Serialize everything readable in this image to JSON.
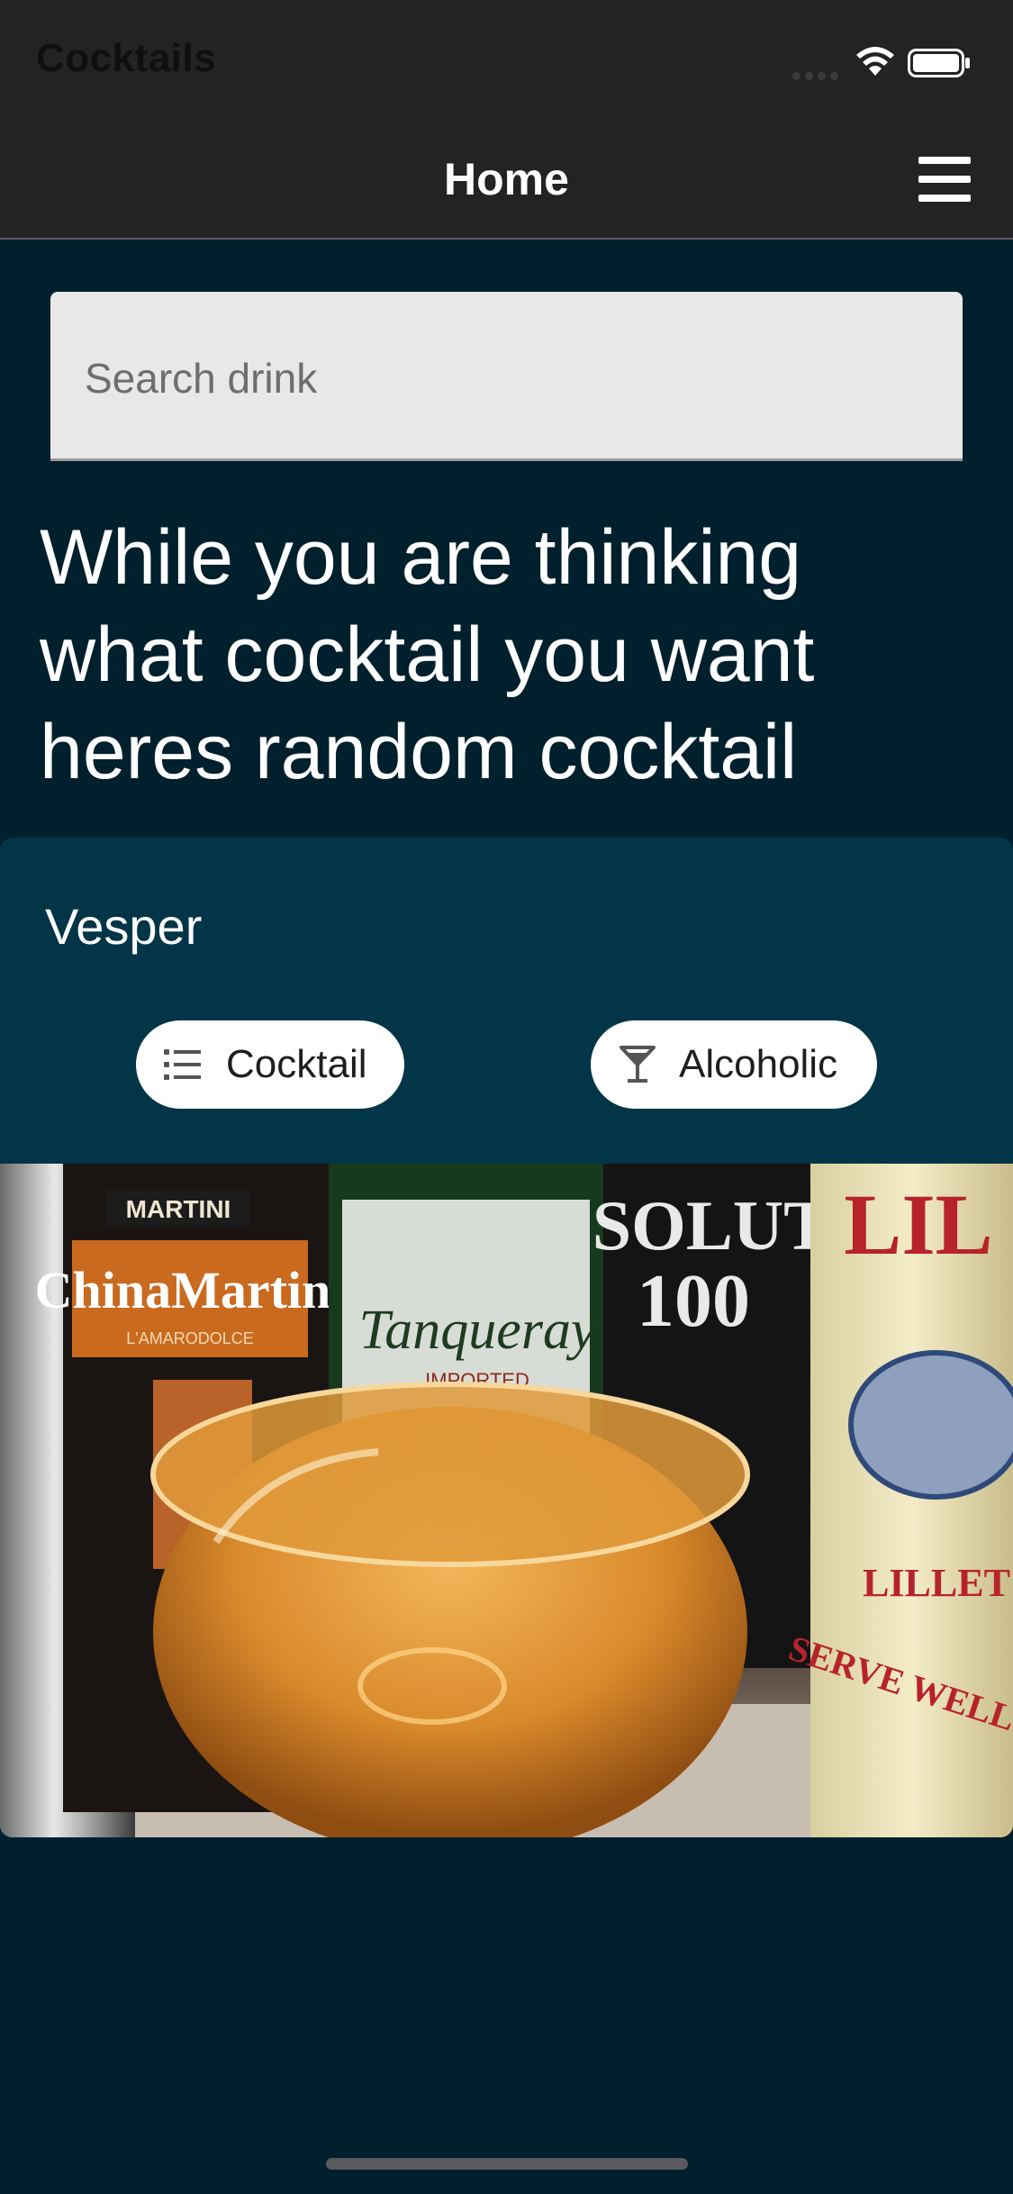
{
  "status_bar": {
    "app_name": "Cocktails"
  },
  "nav": {
    "title": "Home"
  },
  "search": {
    "placeholder": "Search drink",
    "value": ""
  },
  "intro": {
    "text": "While you are thinking what cocktail you want heres random cocktail"
  },
  "random_cocktail": {
    "name": "Vesper",
    "category_label": "Cocktail",
    "category_icon": "list-icon",
    "alcoholic_label": "Alcoholic",
    "alcoholic_icon": "martini-glass-icon",
    "photo_labels": {
      "martini": "MARTINI",
      "china_martini": "ChinaMartini",
      "amarodolce": "L'AMARODOLCE",
      "tanqueray": "Tanqueray",
      "imported": "IMPORTED",
      "absolut": "SOLUT",
      "absolut_100": "100",
      "lillet": "LIL",
      "lillet_bottom": "LILLET",
      "serve_well_ch": "SERVE WELL CH"
    }
  },
  "colors": {
    "background": "#01202d",
    "card": "#023547",
    "bars": "#232324",
    "chip": "#ffffff"
  }
}
